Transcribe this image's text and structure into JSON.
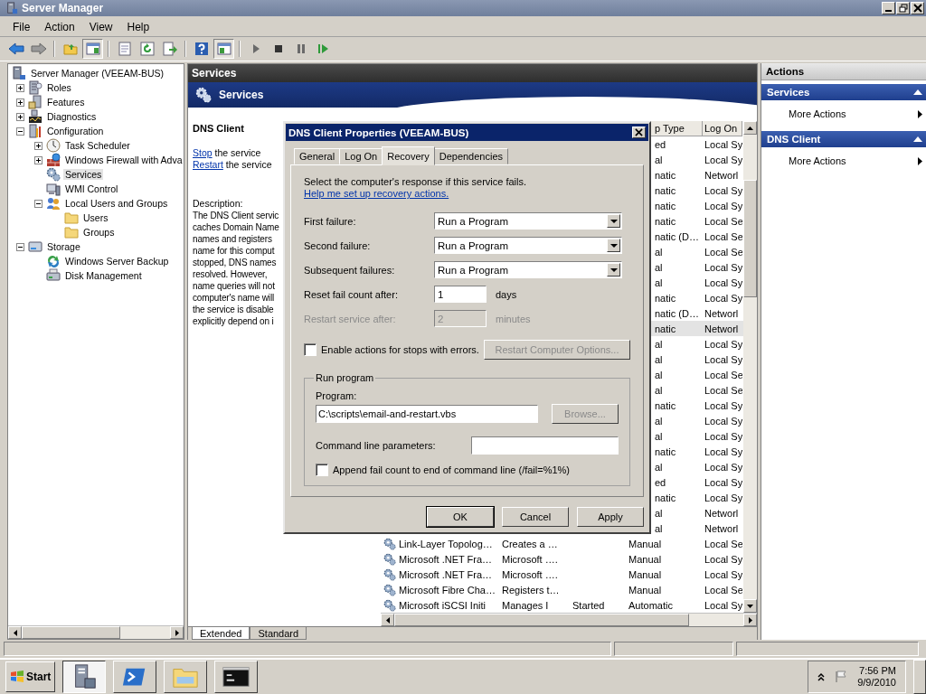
{
  "window": {
    "title": "Server Manager"
  },
  "menu": [
    "File",
    "Action",
    "View",
    "Help"
  ],
  "tree": [
    {
      "label": "Server Manager (VEEAM-BUS)",
      "kind": "server",
      "selected": false,
      "children": [
        {
          "label": "Roles",
          "kind": "roles",
          "expanded": false,
          "selected": false
        },
        {
          "label": "Features",
          "kind": "features",
          "expanded": false,
          "selected": false
        },
        {
          "label": "Diagnostics",
          "kind": "diagnostics",
          "expanded": false,
          "selected": false
        },
        {
          "label": "Configuration",
          "kind": "configuration",
          "expanded": true,
          "selected": false,
          "children": [
            {
              "label": "Task Scheduler",
              "kind": "scheduler",
              "expanded": false,
              "selected": false
            },
            {
              "label": "Windows Firewall with Adva",
              "kind": "firewall",
              "expanded": false,
              "selected": false
            },
            {
              "label": "Services",
              "kind": "services",
              "selected": true
            },
            {
              "label": "WMI Control",
              "kind": "wmi",
              "selected": false
            },
            {
              "label": "Local Users and Groups",
              "kind": "users",
              "expanded": true,
              "selected": false,
              "children": [
                {
                  "label": "Users",
                  "kind": "folder",
                  "selected": false
                },
                {
                  "label": "Groups",
                  "kind": "folder",
                  "selected": false
                }
              ]
            }
          ]
        },
        {
          "label": "Storage",
          "kind": "storage",
          "expanded": true,
          "selected": false,
          "children": [
            {
              "label": "Windows Server Backup",
              "kind": "backup",
              "selected": false
            },
            {
              "label": "Disk Management",
              "kind": "disk",
              "selected": false
            }
          ]
        }
      ]
    }
  ],
  "center": {
    "title": "Services",
    "banner": "Services",
    "details": {
      "heading": "DNS Client",
      "actions": [
        {
          "link": "Stop",
          "rest": " the service"
        },
        {
          "link": "Restart",
          "rest": " the service"
        }
      ],
      "description_label": "Description:",
      "description_lines": [
        "The DNS Client servic",
        "caches Domain Name",
        "names and registers",
        "name for this comput",
        "stopped, DNS names",
        "resolved. However,",
        "name queries will not",
        "computer's name will",
        "the service is disable",
        "explicitly depend on i"
      ]
    },
    "list": {
      "columns": [
        "p Type",
        "Log On"
      ],
      "rows": [
        {
          "kind": "partial",
          "startup_type": "ed",
          "log_on": "Local Sy",
          "selected": false
        },
        {
          "kind": "partial",
          "startup_type": "al",
          "log_on": "Local Sy",
          "selected": false
        },
        {
          "kind": "partial",
          "startup_type": "natic",
          "log_on": "Networl",
          "selected": false
        },
        {
          "kind": "partial",
          "startup_type": "natic",
          "log_on": "Local Sy",
          "selected": false
        },
        {
          "kind": "partial",
          "startup_type": "natic",
          "log_on": "Local Sy",
          "selected": false
        },
        {
          "kind": "partial",
          "startup_type": "natic",
          "log_on": "Local Se",
          "selected": false
        },
        {
          "kind": "partial",
          "startup_type": "natic (D…",
          "log_on": "Local Se",
          "selected": false
        },
        {
          "kind": "partial",
          "startup_type": "al",
          "log_on": "Local Se",
          "selected": false
        },
        {
          "kind": "partial",
          "startup_type": "al",
          "log_on": "Local Sy",
          "selected": false
        },
        {
          "kind": "partial",
          "startup_type": "al",
          "log_on": "Local Sy",
          "selected": false
        },
        {
          "kind": "partial",
          "startup_type": "natic",
          "log_on": "Local Sy",
          "selected": false
        },
        {
          "kind": "partial",
          "startup_type": "natic (D…",
          "log_on": "Networl",
          "selected": false
        },
        {
          "kind": "partial",
          "startup_type": "natic",
          "log_on": "Networl",
          "selected": true
        },
        {
          "kind": "partial",
          "startup_type": "al",
          "log_on": "Local Sy",
          "selected": false
        },
        {
          "kind": "partial",
          "startup_type": "al",
          "log_on": "Local Sy",
          "selected": false
        },
        {
          "kind": "partial",
          "startup_type": "al",
          "log_on": "Local Se",
          "selected": false
        },
        {
          "kind": "partial",
          "startup_type": "al",
          "log_on": "Local Se",
          "selected": false
        },
        {
          "kind": "partial",
          "startup_type": "natic",
          "log_on": "Local Sy",
          "selected": false
        },
        {
          "kind": "partial",
          "startup_type": "al",
          "log_on": "Local Sy",
          "selected": false
        },
        {
          "kind": "partial",
          "startup_type": "al",
          "log_on": "Local Sy",
          "selected": false
        },
        {
          "kind": "partial",
          "startup_type": "natic",
          "log_on": "Local Sy",
          "selected": false
        },
        {
          "kind": "partial",
          "startup_type": "al",
          "log_on": "Local Sy",
          "selected": false
        },
        {
          "kind": "partial",
          "startup_type": "ed",
          "log_on": "Local Sy",
          "selected": false
        },
        {
          "kind": "partial",
          "startup_type": "natic",
          "log_on": "Local Sy",
          "selected": false
        },
        {
          "kind": "partial",
          "startup_type": "al",
          "log_on": "Networl",
          "selected": false
        },
        {
          "kind": "partial",
          "startup_type": "al",
          "log_on": "Networl",
          "selected": false
        },
        {
          "kind": "full",
          "name": "Link-Layer Topolog…",
          "description": "Creates a …",
          "startup_type": "Manual",
          "log_on": "Local Se",
          "selected": false
        },
        {
          "kind": "full",
          "name": "Microsoft .NET Fra…",
          "description": "Microsoft ….",
          "startup_type": "Manual",
          "log_on": "Local Sy",
          "selected": false
        },
        {
          "kind": "full",
          "name": "Microsoft .NET Fra…",
          "description": "Microsoft ….",
          "startup_type": "Manual",
          "log_on": "Local Sy",
          "selected": false
        },
        {
          "kind": "full",
          "name": "Microsoft Fibre Cha…",
          "description": "Registers t…",
          "startup_type": "Manual",
          "log_on": "Local Se",
          "selected": false
        },
        {
          "kind": "full",
          "name": "Microsoft iSCSI Initi",
          "description": "Manages I",
          "status": "Started",
          "startup_type": "Automatic",
          "log_on": "Local Sy",
          "selected": false
        }
      ]
    },
    "view_tabs": [
      {
        "label": "Extended",
        "selected": true
      },
      {
        "label": "Standard",
        "selected": false
      }
    ]
  },
  "dialog": {
    "title": "DNS Client Properties (VEEAM-BUS)",
    "tabs": [
      {
        "label": "General",
        "selected": false
      },
      {
        "label": "Log On",
        "selected": false
      },
      {
        "label": "Recovery",
        "selected": true
      },
      {
        "label": "Dependencies",
        "selected": false
      }
    ],
    "intro": "Select the computer's response if this service fails.",
    "help_link": "Help me set up recovery actions.",
    "failures": [
      {
        "label": "First failure:",
        "value": "Run a Program"
      },
      {
        "label": "Second failure:",
        "value": "Run a Program"
      },
      {
        "label": "Subsequent failures:",
        "value": "Run a Program"
      }
    ],
    "counters": [
      {
        "label": "Reset fail count after:",
        "value": "1",
        "unit": "days",
        "disabled": false
      },
      {
        "label": "Restart service after:",
        "value": "2",
        "unit": "minutes",
        "disabled": true
      }
    ],
    "enable_actions": {
      "label": "Enable actions for stops with errors.",
      "checked": false
    },
    "restart_options_button": {
      "label": "Restart Computer Options...",
      "disabled": true
    },
    "run_program": {
      "title": "Run program",
      "program_label": "Program:",
      "program_value": "C:\\scripts\\email-and-restart.vbs",
      "browse": {
        "label": "Browse...",
        "disabled": true
      },
      "params_label": "Command line parameters:",
      "append": {
        "label": "Append fail count to end of command line (/fail=%1%)",
        "checked": false
      }
    },
    "buttons": [
      {
        "label": "OK",
        "default": true
      },
      {
        "label": "Cancel",
        "default": false
      },
      {
        "label": "Apply",
        "default": false
      }
    ]
  },
  "actions_pane": {
    "title": "Actions",
    "sections": [
      {
        "title": "Services",
        "expanded": true,
        "items": [
          "More Actions"
        ]
      },
      {
        "title": "DNS Client",
        "expanded": true,
        "items": [
          "More Actions"
        ]
      }
    ]
  },
  "taskbar": {
    "start": "Start",
    "apps": [
      {
        "kind": "server-manager",
        "selected": true
      },
      {
        "kind": "powershell",
        "selected": false
      },
      {
        "kind": "explorer",
        "selected": false
      },
      {
        "kind": "console",
        "selected": false
      }
    ],
    "clock": {
      "time": "7:56 PM",
      "date": "9/9/2010"
    }
  }
}
